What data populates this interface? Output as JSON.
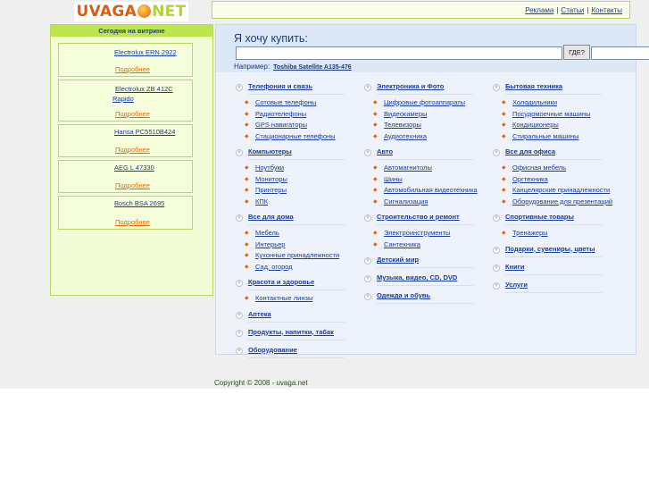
{
  "logo": {
    "part1": "UVAGA",
    "part2": "NET"
  },
  "top_links": [
    {
      "label": "Реклама"
    },
    {
      "label": "Статьи"
    },
    {
      "label": "Контакты"
    }
  ],
  "left_panel": {
    "title": "Сегодня на витрине",
    "items": [
      {
        "name": "Electrolux ERN 2922",
        "more": "Подробнее"
      },
      {
        "name": "Electrolux ZB 412C",
        "name2": "Rapido",
        "more": "Подробнее"
      },
      {
        "name": "Hansa PC5510B424",
        "more": "Подробнее"
      },
      {
        "name": "AEG L 47330",
        "more": "Подробнее"
      },
      {
        "name": "Bosch BSA 2695",
        "more": "Подробнее"
      }
    ]
  },
  "search": {
    "title": "Я хочу купить:",
    "where_label": "ГДЕ?",
    "example_label": "Например:",
    "example_link": "Toshiba Satellite A135-476"
  },
  "columns": [
    [
      {
        "title": "Телефония и связь",
        "items": [
          "Сотовые телефоны",
          "Радиотелефоны",
          "GPS навигаторы",
          "Стационарные телефоны"
        ]
      },
      {
        "title": "Компьютеры",
        "items": [
          "Ноутбуки",
          "Мониторы",
          "Принтеры",
          "КПК"
        ]
      },
      {
        "title": "Все для дома",
        "items": [
          "Мебель",
          "Интерьер",
          "Кухонные принадлежности",
          "Сад, огород"
        ]
      },
      {
        "title": "Красота и здоровье",
        "items": [
          "Контактные линзы"
        ]
      },
      {
        "title": "Аптека",
        "items": []
      },
      {
        "title": "Продукты, напитки, табак",
        "items": []
      },
      {
        "title": "Оборудование",
        "items": []
      }
    ],
    [
      {
        "title": "Электроника и Фото",
        "items": [
          "Цифровые фотоаппараты",
          "Видеокамеры",
          "Телевизоры",
          "Аудиотехника"
        ]
      },
      {
        "title": "Авто",
        "items": [
          "Автомагнитолы",
          "Шины",
          "Автомобильная видеотехника",
          "Сигнализация"
        ]
      },
      {
        "title": "Строительство и ремонт",
        "items": [
          "Электроинструменты",
          "Сантехника"
        ]
      },
      {
        "title": "Детский мир",
        "items": []
      },
      {
        "title": "Музыка, видео, CD, DVD",
        "items": []
      },
      {
        "title": "Одежда и обувь",
        "items": []
      }
    ],
    [
      {
        "title": "Бытовая техника",
        "items": [
          "Холодильники",
          "Посудомоечные машины",
          "Кондиционеры",
          "Стиральные машины"
        ]
      },
      {
        "title": "Все для офиса",
        "items": [
          "Офисная мебель",
          "Оргтехника",
          "Канцелярские принадлежности",
          "Оборудование для презентаций"
        ]
      },
      {
        "title": "Спортивные товары",
        "items": [
          "Тренажеры"
        ]
      },
      {
        "title": "Подарки, сувениры, цветы",
        "items": []
      },
      {
        "title": "Книги",
        "items": []
      },
      {
        "title": "Услуги",
        "items": []
      }
    ]
  ],
  "footer": "Copyright © 2008 - uvaga.net"
}
